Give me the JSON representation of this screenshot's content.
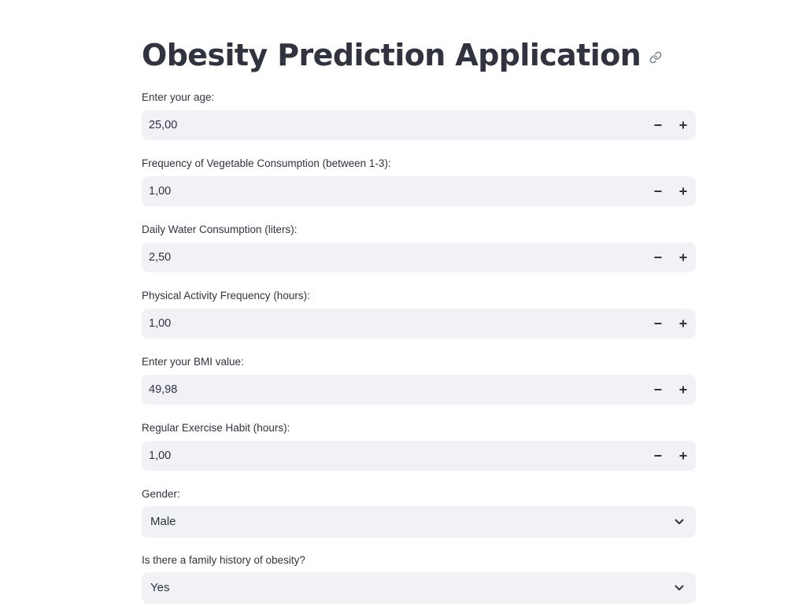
{
  "header": {
    "title": "Obesity Prediction Application"
  },
  "form": {
    "age": {
      "label": "Enter your age:",
      "value": "25,00"
    },
    "vegetables": {
      "label": "Frequency of Vegetable Consumption (between 1-3):",
      "value": "1,00"
    },
    "water": {
      "label": "Daily Water Consumption (liters):",
      "value": "2,50"
    },
    "activity": {
      "label": "Physical Activity Frequency (hours):",
      "value": "1,00"
    },
    "bmi": {
      "label": "Enter your BMI value:",
      "value": "49,98"
    },
    "exercise": {
      "label": "Regular Exercise Habit (hours):",
      "value": "1,00"
    },
    "gender": {
      "label": "Gender:",
      "value": "Male"
    },
    "family_history": {
      "label": "Is there a family history of obesity?",
      "value": "Yes"
    }
  },
  "colors": {
    "text": "#31333f",
    "input_background": "#f0f2f6",
    "page_background": "#ffffff"
  },
  "icons": {
    "anchor": "link-icon",
    "decrement": "minus-icon",
    "increment": "plus-icon",
    "dropdown": "chevron-down-icon"
  }
}
